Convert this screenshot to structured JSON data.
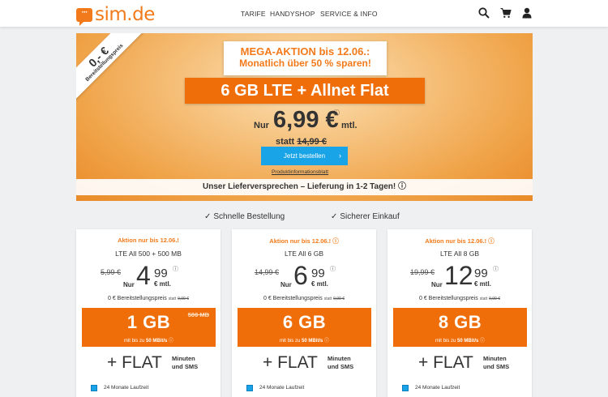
{
  "brand": {
    "logo_mark": "···",
    "name": "sim.de",
    "accent": "#f27a1a"
  },
  "nav": {
    "items": [
      "TARIFE",
      "HANDYSHOP",
      "SERVICE & INFO"
    ]
  },
  "header_icons": [
    "search-icon",
    "cart-icon",
    "user-icon"
  ],
  "hero": {
    "ribbon_price": "0,- €",
    "ribbon_label": "Bereitstellungspreis",
    "promo_line1": "MEGA-AKTION bis 12.06.:",
    "promo_line2": "Monatlich über 50 % sparen!",
    "offer": "6 GB LTE + Allnet Flat",
    "price_prefix": "Nur",
    "price": "6,99 €",
    "price_info": "ⓘ",
    "price_suffix": "mtl.",
    "statt_label": "statt",
    "old_price": "14,99 €",
    "button_label": "Jetzt bestellen",
    "button_chevron": "›",
    "product_info_link": "Produktinformationsblatt",
    "delivery_text": "Unser Lieferversprechen – Lieferung in 1-2 Tagen! ⓘ"
  },
  "trust": [
    {
      "check": "✓",
      "label": "Schnelle Bestellung"
    },
    {
      "check": "✓",
      "label": "Sicherer Einkauf"
    }
  ],
  "cards": [
    {
      "aktion": "Aktion nur bis 12.06.!",
      "plan": "LTE All 500 + 500 MB",
      "old_price": "5,99 €",
      "nur": "Nur",
      "euro": "4",
      "cents": "99",
      "info": "ⓘ",
      "mtl": "€ mtl.",
      "setup_main": "0 € Bereitstellungspreis",
      "setup_statt": "statt",
      "setup_old": "9,99 €",
      "data": "1 GB",
      "data_strike": "500 MB",
      "speed_prefix": "mit bis zu",
      "speed": "50 MBit/s",
      "speed_info": "ⓘ",
      "flat": "+ FLAT",
      "flat_sub1": "Minuten",
      "flat_sub2": "und SMS",
      "checkbox_label": "24 Monate Laufzeit"
    },
    {
      "aktion": "Aktion nur bis 12.06.! ⓘ",
      "plan": "LTE All 6 GB",
      "old_price": "14,99 €",
      "nur": "Nur",
      "euro": "6",
      "cents": "99",
      "info": "ⓘ",
      "mtl": "€ mtl.",
      "setup_main": "0 € Bereitstellungspreis",
      "setup_statt": "statt",
      "setup_old": "9,99 €",
      "data": "6 GB",
      "data_strike": "",
      "speed_prefix": "mit bis zu",
      "speed": "50 MBit/s",
      "speed_info": "ⓘ",
      "flat": "+ FLAT",
      "flat_sub1": "Minuten",
      "flat_sub2": "und SMS",
      "checkbox_label": "24 Monate Laufzeit"
    },
    {
      "aktion": "Aktion nur bis 12.06.! ⓘ",
      "plan": "LTE All 8 GB",
      "old_price": "19,99 €",
      "nur": "Nur",
      "euro": "12",
      "cents": "99",
      "info": "ⓘ",
      "mtl": "€ mtl.",
      "setup_main": "0 € Bereitstellungspreis",
      "setup_statt": "statt",
      "setup_old": "9,99 €",
      "data": "8 GB",
      "data_strike": "",
      "speed_prefix": "mit bis zu",
      "speed": "50 MBit/s",
      "speed_info": "ⓘ",
      "flat": "+ FLAT",
      "flat_sub1": "Minuten",
      "flat_sub2": "und SMS",
      "checkbox_label": "24 Monate Laufzeit"
    }
  ]
}
